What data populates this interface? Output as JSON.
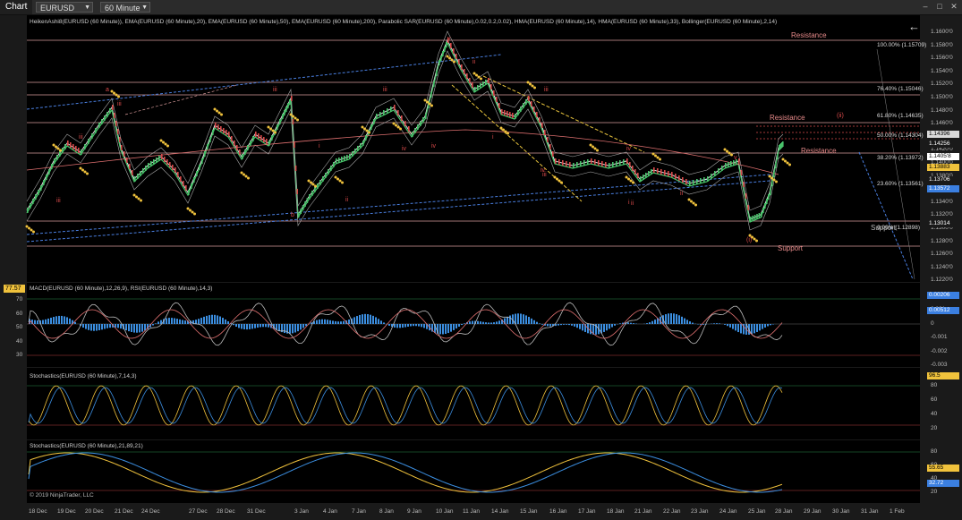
{
  "window": {
    "tab": "Chart",
    "instrument": "EURUSD",
    "interval": "60 Minute",
    "back_icon": "back-arrow-icon"
  },
  "price_panel": {
    "title": "HeikenAshi8(EURUSD (60 Minute)), EMA(EURUSD (60 Minute),20), EMA(EURUSD (60 Minute),50), EMA(EURUSD (60 Minute),200), Parabolic SAR(EURUSD (60 Minute),0.02,0.2,0.02), HMA(EURUSD (60 Minute),14), HMA(EURUSD (60 Minute),33), Bollinger(EURUSD (60 Minute),2,14)",
    "y_ticks": [
      "1.1600'0",
      "1.1580'0",
      "1.1560'0",
      "1.1540'0",
      "1.1520'0",
      "1.1500'0",
      "1.1480'0",
      "1.1460'0",
      "1.1440'0",
      "1.1420'0",
      "1.1400'0",
      "1.1380'0",
      "1.1360'0",
      "1.1340'0",
      "1.1320'0",
      "1.1300'0",
      "1.1280'0",
      "1.1260'0",
      "1.1240'0",
      "1.1220'0"
    ],
    "price_tags": [
      {
        "text": "1.14396",
        "color": "#d8d8d8",
        "text_color": "#000"
      },
      {
        "text": "1.14256",
        "color": "#1a1a1a",
        "text_color": "#fff"
      },
      {
        "text": "1.1405'8",
        "color": "#ffffff",
        "text_color": "#000"
      },
      {
        "text": "1.13883",
        "color": "#f0c23c",
        "text_color": "#000"
      },
      {
        "text": "1.13706",
        "color": "#1a1a1a",
        "text_color": "#fff"
      },
      {
        "text": "1.13572",
        "color": "#3b7fe0",
        "text_color": "#fff"
      },
      {
        "text": "1.13014",
        "color": "#1a1a1a",
        "text_color": "#fff"
      }
    ],
    "fib_levels": [
      {
        "text": "100.00% (1.15709)",
        "color": "#e0e0e0"
      },
      {
        "text": "76.40% (1.15046)",
        "color": "#49c36b"
      },
      {
        "text": "61.80% (1.14635)",
        "color": "#2fc2c6"
      },
      {
        "text": "50.00% (1.14304)",
        "color": "#3b7fe0"
      },
      {
        "text": "38.20% (1.13972)",
        "color": "#3b7fe0"
      },
      {
        "text": "23.60% (1.13561)",
        "color": "#3b7fe0"
      },
      {
        "text": "0.00% (1.12898)",
        "color": "#e0e0e0"
      }
    ],
    "labels": {
      "resistance_top": "Resistance",
      "resistance_mid": "Resistance",
      "resistance_low": "Resistance",
      "support_low": "Support",
      "support_right": "Support"
    },
    "wave_labels": [
      "a",
      "iii",
      "iii",
      "iii",
      "iii",
      "i",
      "ii",
      "iv",
      "b",
      "ii",
      "v",
      "iv",
      "iv",
      "(i)",
      "(ii)",
      "iii",
      "i",
      "iii",
      "iv",
      "ii",
      "i",
      "ii",
      "v",
      "iii"
    ]
  },
  "macd_panel": {
    "title": "MACD(EURUSD (60 Minute),12,26,9), RSI(EURUSD (60 Minute),14,3)",
    "left_ticks": [
      "70",
      "60",
      "50",
      "40",
      "30"
    ],
    "right_ticks": [
      "0.001",
      "0",
      "-0.001",
      "-0.002",
      "-0.003"
    ],
    "left_tag": "77.57",
    "tags": [
      {
        "text": "0.00206",
        "color": "#3b7fe0"
      },
      {
        "text": "0.00512",
        "color": "#3b7fe0"
      }
    ]
  },
  "stoch1_panel": {
    "title": "Stochastics(EURUSD (60 Minute),7,14,3)",
    "ticks": [
      "80",
      "60",
      "40",
      "20"
    ],
    "tags": [
      {
        "text": "96.5",
        "color": "#f0c23c"
      }
    ]
  },
  "stoch2_panel": {
    "title": "Stochastics(EURUSD (60 Minute),21,89,21)",
    "ticks": [
      "80",
      "60",
      "40",
      "20"
    ],
    "tags": [
      {
        "text": "55.65",
        "color": "#f0c23c"
      },
      {
        "text": "32.72",
        "color": "#3b7fe0"
      }
    ],
    "copyright": "© 2019 NinjaTrader, LLC"
  },
  "x_axis": [
    "18 Dec",
    "19 Dec",
    "20 Dec",
    "21 Dec",
    "24 Dec",
    "27 Dec",
    "28 Dec",
    "31 Dec",
    "3 Jan",
    "4 Jan",
    "7 Jan",
    "8 Jan",
    "9 Jan",
    "10 Jan",
    "11 Jan",
    "14 Jan",
    "15 Jan",
    "16 Jan",
    "17 Jan",
    "18 Jan",
    "21 Jan",
    "22 Jan",
    "23 Jan",
    "24 Jan",
    "25 Jan",
    "28 Jan",
    "29 Jan",
    "30 Jan",
    "31 Jan",
    "1 Feb"
  ],
  "colors": {
    "bull": "#49c36b",
    "bear": "#d84a4a",
    "sar": "#f0c23c",
    "hma": "#ffffff",
    "ema": "#e07070",
    "trend": "#4a7fe0"
  }
}
